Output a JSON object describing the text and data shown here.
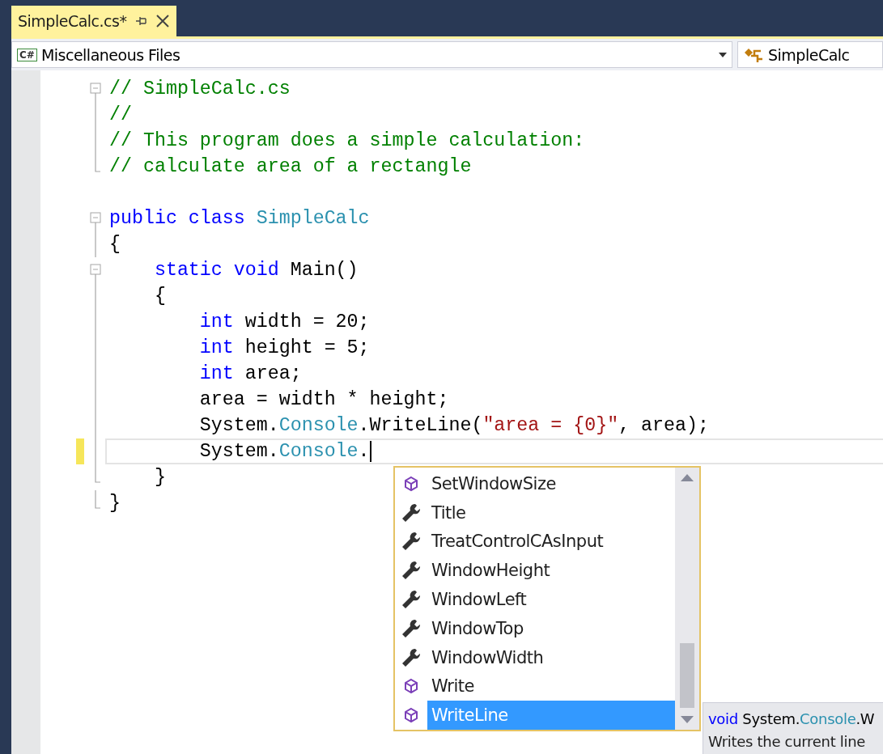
{
  "tab": {
    "title": "SimpleCalc.cs*",
    "active": true
  },
  "nav": {
    "project": "Miscellaneous Files",
    "project_badge": "C#",
    "member": "SimpleCalc"
  },
  "code_lines": [
    {
      "kind": "fold-start",
      "current": false,
      "tokens": [
        {
          "kind": "comment",
          "text": "// SimpleCalc.cs"
        }
      ]
    },
    {
      "kind": "fold-line",
      "current": false,
      "tokens": [
        {
          "kind": "comment",
          "text": "//"
        }
      ]
    },
    {
      "kind": "fold-line",
      "current": false,
      "tokens": [
        {
          "kind": "comment",
          "text": "// This program does a simple calculation:"
        }
      ]
    },
    {
      "kind": "fold-end",
      "current": false,
      "tokens": [
        {
          "kind": "comment",
          "text": "// calculate area of a rectangle"
        }
      ]
    },
    {
      "kind": "blank",
      "current": false
    },
    {
      "kind": "fold-start",
      "current": false,
      "tokens": [
        {
          "kind": "keyword",
          "text": "public class "
        },
        {
          "kind": "type",
          "text": "SimpleCalc"
        }
      ]
    },
    {
      "kind": "fold-line",
      "current": false,
      "tokens": [
        {
          "kind": "plain",
          "text": "{"
        }
      ]
    },
    {
      "kind": "fold-start",
      "current": false,
      "tokens": [
        {
          "kind": "keyword",
          "text": "    static void "
        },
        {
          "kind": "plain",
          "text": "Main()"
        }
      ]
    },
    {
      "kind": "fold-line",
      "current": false,
      "tokens": [
        {
          "kind": "plain",
          "text": "    {"
        }
      ]
    },
    {
      "kind": "fold-line",
      "current": false,
      "tokens": [
        {
          "kind": "keyword",
          "text": "        int "
        },
        {
          "kind": "plain",
          "text": "width = 20;"
        }
      ]
    },
    {
      "kind": "fold-line",
      "current": false,
      "tokens": [
        {
          "kind": "keyword",
          "text": "        int "
        },
        {
          "kind": "plain",
          "text": "height = 5;"
        }
      ]
    },
    {
      "kind": "fold-line",
      "current": false,
      "tokens": [
        {
          "kind": "keyword",
          "text": "        int "
        },
        {
          "kind": "plain",
          "text": "area;"
        }
      ]
    },
    {
      "kind": "fold-line",
      "current": false,
      "tokens": [
        {
          "kind": "plain",
          "text": "        area = width * height;"
        }
      ]
    },
    {
      "kind": "fold-line",
      "current": false,
      "tokens": [
        {
          "kind": "plain",
          "text": "        System."
        },
        {
          "kind": "type",
          "text": "Console"
        },
        {
          "kind": "plain",
          "text": ".WriteLine("
        },
        {
          "kind": "string",
          "text": "\"area = {0}\""
        },
        {
          "kind": "plain",
          "text": ", area);"
        }
      ]
    },
    {
      "kind": "fold-line",
      "current": true,
      "tokens": [
        {
          "kind": "plain",
          "text": "        System."
        },
        {
          "kind": "type",
          "text": "Console"
        },
        {
          "kind": "plain",
          "text": "."
        }
      ]
    },
    {
      "kind": "fold-end",
      "current": false,
      "tokens": [
        {
          "kind": "plain",
          "text": "    }"
        }
      ]
    },
    {
      "kind": "fold-end",
      "current": false,
      "tokens": [
        {
          "kind": "plain",
          "text": "}"
        }
      ]
    }
  ],
  "completion": {
    "items": [
      {
        "kind": "method",
        "label": "SetWindowSize",
        "selected": false
      },
      {
        "kind": "property",
        "label": "Title",
        "selected": false
      },
      {
        "kind": "property",
        "label": "TreatControlCAsInput",
        "selected": false
      },
      {
        "kind": "property",
        "label": "WindowHeight",
        "selected": false
      },
      {
        "kind": "property",
        "label": "WindowLeft",
        "selected": false
      },
      {
        "kind": "property",
        "label": "WindowTop",
        "selected": false
      },
      {
        "kind": "property",
        "label": "WindowWidth",
        "selected": false
      },
      {
        "kind": "method",
        "label": "Write",
        "selected": false
      },
      {
        "kind": "method",
        "label": "WriteLine",
        "selected": true
      }
    ]
  },
  "tooltip": {
    "signature": [
      {
        "kind": "keyword",
        "text": "void "
      },
      {
        "kind": "plain",
        "text": "System."
      },
      {
        "kind": "type",
        "text": "Console"
      },
      {
        "kind": "plain",
        "text": ".W"
      }
    ],
    "description": "Writes the current line"
  }
}
